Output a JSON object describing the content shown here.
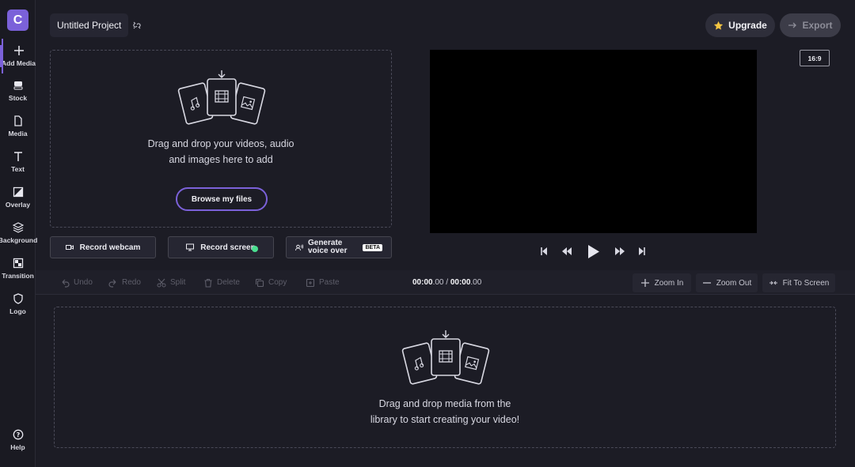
{
  "app": {
    "logo_letter": "C"
  },
  "sidebar": {
    "items": [
      {
        "label": "Add Media",
        "icon": "plus-icon"
      },
      {
        "label": "Stock",
        "icon": "stock-icon"
      },
      {
        "label": "Media",
        "icon": "file-icon"
      },
      {
        "label": "Text",
        "icon": "text-icon"
      },
      {
        "label": "Overlay",
        "icon": "overlay-icon"
      },
      {
        "label": "Background",
        "icon": "layers-icon"
      },
      {
        "label": "Transition",
        "icon": "transition-icon"
      },
      {
        "label": "Logo",
        "icon": "shield-icon"
      }
    ],
    "help": "Help"
  },
  "header": {
    "project_title": "Untitled Project",
    "upgrade_label": "Upgrade",
    "export_label": "Export"
  },
  "media_panel": {
    "drop_line1": "Drag and drop your videos, audio",
    "drop_line2": "and images here to add",
    "browse_label": "Browse my files",
    "record_webcam": "Record webcam",
    "record_screen": "Record screen",
    "voice_line1": "Generate",
    "voice_line2": "voice over",
    "beta": "BETA"
  },
  "preview": {
    "aspect_ratio": "16:9"
  },
  "toolbar": {
    "undo": "Undo",
    "redo": "Redo",
    "split": "Split",
    "delete": "Delete",
    "copy": "Copy",
    "paste": "Paste",
    "time_current_bold": "00:00",
    "time_current_frac": ".00",
    "time_sep": " / ",
    "time_total_bold": "00:00",
    "time_total_frac": ".00",
    "zoom_in": "Zoom In",
    "zoom_out": "Zoom Out",
    "fit": "Fit To Screen"
  },
  "timeline": {
    "drop_line1": "Drag and drop media from the",
    "drop_line2": "library to start creating your video!"
  },
  "colors": {
    "accent": "#7b61d9",
    "record_dot": "#4ade90",
    "star": "#f5c542"
  }
}
